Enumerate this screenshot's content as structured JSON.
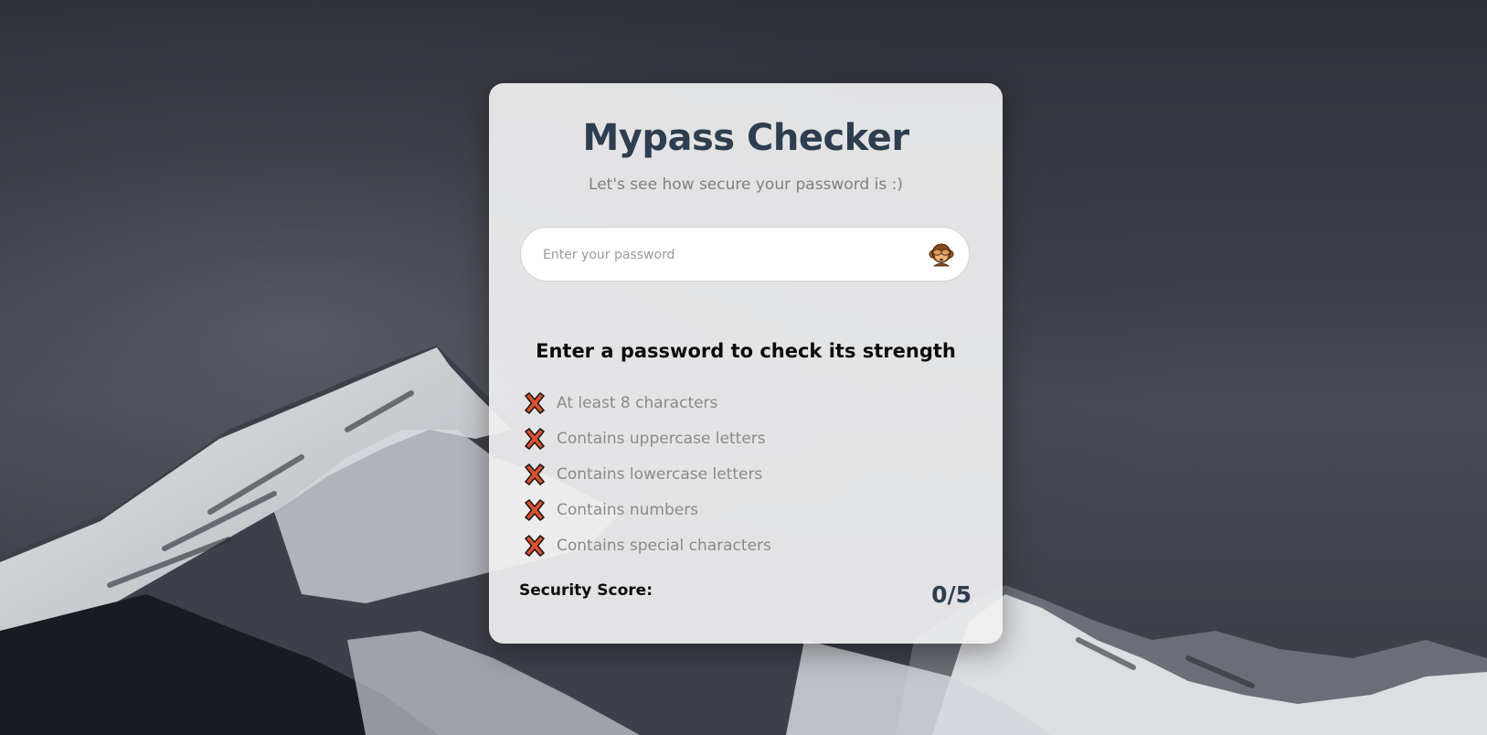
{
  "app": {
    "title": "Mypass Checker",
    "subtitle": "Let's see how secure your password is :)"
  },
  "password_field": {
    "value": "",
    "placeholder": "Enter your password",
    "toggle_icon": "see-no-evil-monkey-icon"
  },
  "strength": {
    "heading": "Enter a password to check its strength",
    "criteria": [
      {
        "label": "At least 8 characters",
        "met": false,
        "icon": "cross-mark-icon"
      },
      {
        "label": "Contains uppercase letters",
        "met": false,
        "icon": "cross-mark-icon"
      },
      {
        "label": "Contains lowercase letters",
        "met": false,
        "icon": "cross-mark-icon"
      },
      {
        "label": "Contains numbers",
        "met": false,
        "icon": "cross-mark-icon"
      },
      {
        "label": "Contains special characters",
        "met": false,
        "icon": "cross-mark-icon"
      }
    ]
  },
  "score": {
    "label": "Security Score:",
    "value": "0/5"
  },
  "colors": {
    "title": "#2c3e50",
    "cross": "#e0502a",
    "card": "#f0f0f1"
  }
}
